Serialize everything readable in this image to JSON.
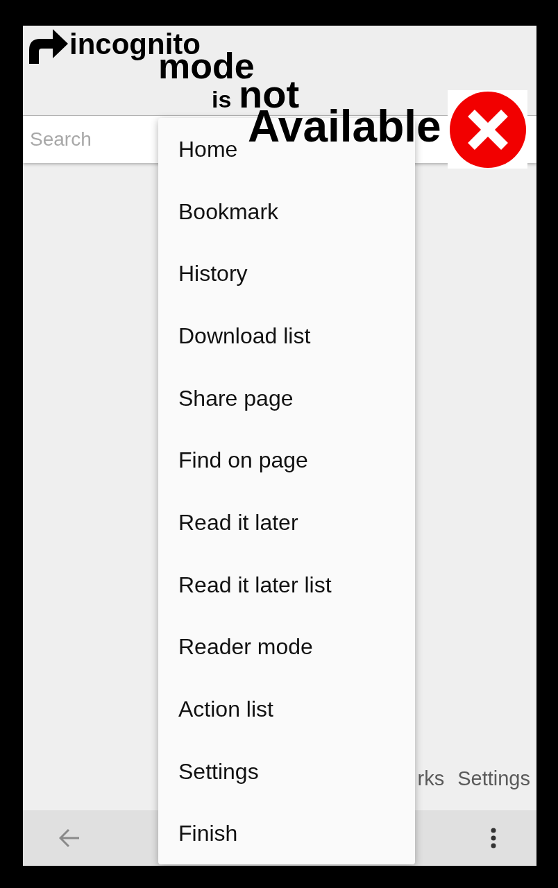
{
  "annotation": {
    "words": [
      {
        "text": "incognito"
      },
      {
        "text": "mode"
      },
      {
        "text": "is"
      },
      {
        "text": "not"
      },
      {
        "text": "Available"
      }
    ]
  },
  "search": {
    "placeholder": "Search"
  },
  "background_links": [
    "rks",
    "Settings"
  ],
  "menu": {
    "items": [
      "Home",
      "Bookmark",
      "History",
      "Download list",
      "Share page",
      "Find on page",
      "Read it later",
      "Read it later list",
      "Reader mode",
      "Action list",
      "Settings",
      "Finish"
    ]
  }
}
